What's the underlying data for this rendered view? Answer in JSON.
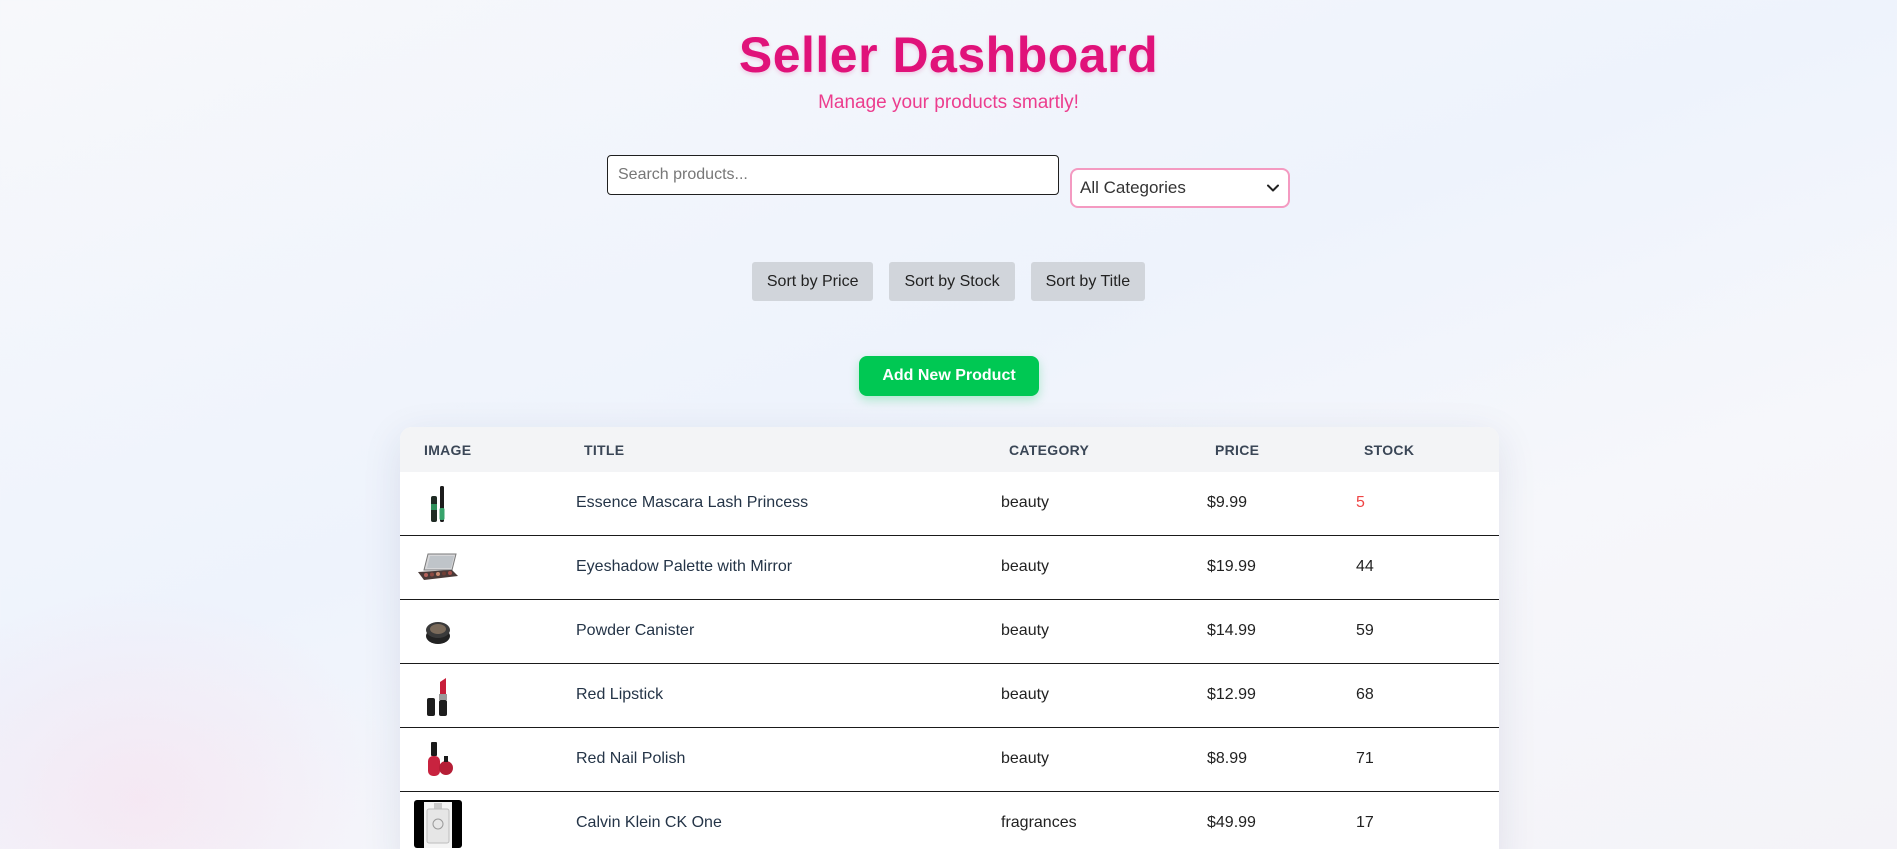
{
  "header": {
    "title": "Seller Dashboard",
    "subtitle": "Manage your products smartly!"
  },
  "search": {
    "placeholder": "Search products...",
    "value": ""
  },
  "category_filter": {
    "selected": "All Categories"
  },
  "sort_buttons": {
    "price": "Sort by Price",
    "stock": "Sort by Stock",
    "title": "Sort by Title"
  },
  "add_button": "Add New Product",
  "table": {
    "columns": {
      "image": "IMAGE",
      "title": "TITLE",
      "category": "CATEGORY",
      "price": "PRICE",
      "stock": "STOCK"
    },
    "rows": [
      {
        "image_icon": "mascara-icon",
        "title": "Essence Mascara Lash Princess",
        "category": "beauty",
        "price": "$9.99",
        "stock": "5"
      },
      {
        "image_icon": "eyeshadow-palette-icon",
        "title": "Eyeshadow Palette with Mirror",
        "category": "beauty",
        "price": "$19.99",
        "stock": "44"
      },
      {
        "image_icon": "powder-canister-icon",
        "title": "Powder Canister",
        "category": "beauty",
        "price": "$14.99",
        "stock": "59"
      },
      {
        "image_icon": "lipstick-icon",
        "title": "Red Lipstick",
        "category": "beauty",
        "price": "$12.99",
        "stock": "68"
      },
      {
        "image_icon": "nail-polish-icon",
        "title": "Red Nail Polish",
        "category": "beauty",
        "price": "$8.99",
        "stock": "71"
      },
      {
        "image_icon": "perfume-bottle-icon",
        "title": "Calvin Klein CK One",
        "category": "fragrances",
        "price": "$49.99",
        "stock": "17"
      }
    ]
  },
  "colors": {
    "title": "#e0127a",
    "subtitle": "#ec3d8e",
    "add_button": "#00c853",
    "low_stock": "#ef4444",
    "select_border": "#f49ac1"
  }
}
